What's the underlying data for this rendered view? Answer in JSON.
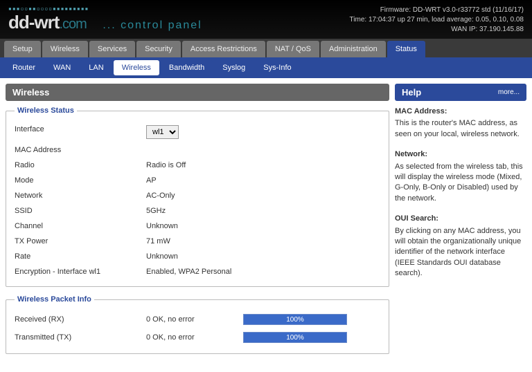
{
  "header": {
    "firmware": "Firmware: DD-WRT v3.0-r33772 std (11/16/17)",
    "time": "Time: 17:04:37 up 27 min, load average: 0.05, 0.10, 0.08",
    "wan_ip": "WAN IP: 37.190.145.88",
    "logo_main": "dd-wrt",
    "logo_suffix": ".com",
    "control_panel": "... control panel"
  },
  "main_tabs": [
    "Setup",
    "Wireless",
    "Services",
    "Security",
    "Access Restrictions",
    "NAT / QoS",
    "Administration",
    "Status"
  ],
  "main_tab_active": 7,
  "sub_tabs": [
    "Router",
    "WAN",
    "LAN",
    "Wireless",
    "Bandwidth",
    "Syslog",
    "Sys-Info"
  ],
  "sub_tab_active": 3,
  "page_title": "Wireless",
  "wireless_status": {
    "legend": "Wireless Status",
    "interface_label": "Interface",
    "interface_value": "wl1",
    "rows": [
      {
        "label": "MAC Address",
        "value": ""
      },
      {
        "label": "Radio",
        "value": "Radio is Off"
      },
      {
        "label": "Mode",
        "value": "AP"
      },
      {
        "label": "Network",
        "value": "AC-Only"
      },
      {
        "label": "SSID",
        "value": "5GHz"
      },
      {
        "label": "Channel",
        "value": "Unknown"
      },
      {
        "label": "TX Power",
        "value": "71 mW"
      },
      {
        "label": "Rate",
        "value": "Unknown"
      },
      {
        "label": "Encryption - Interface wl1",
        "value": "Enabled, WPA2 Personal"
      }
    ]
  },
  "packet_info": {
    "legend": "Wireless Packet Info",
    "rows": [
      {
        "label": "Received (RX)",
        "value": "0 OK, no error",
        "pct": "100%"
      },
      {
        "label": "Transmitted (TX)",
        "value": "0 OK, no error",
        "pct": "100%"
      }
    ]
  },
  "help": {
    "title": "Help",
    "more": "more...",
    "sections": [
      {
        "h": "MAC Address:",
        "p": "This is the router's MAC address, as seen on your local, wireless network."
      },
      {
        "h": "Network:",
        "p": "As selected from the wireless tab, this will display the wireless mode (Mixed, G-Only, B-Only or Disabled) used by the network."
      },
      {
        "h": "OUI Search:",
        "p": "By clicking on any MAC address, you will obtain the organizationally unique identifier of the network interface (IEEE Standards OUI database search)."
      }
    ]
  }
}
